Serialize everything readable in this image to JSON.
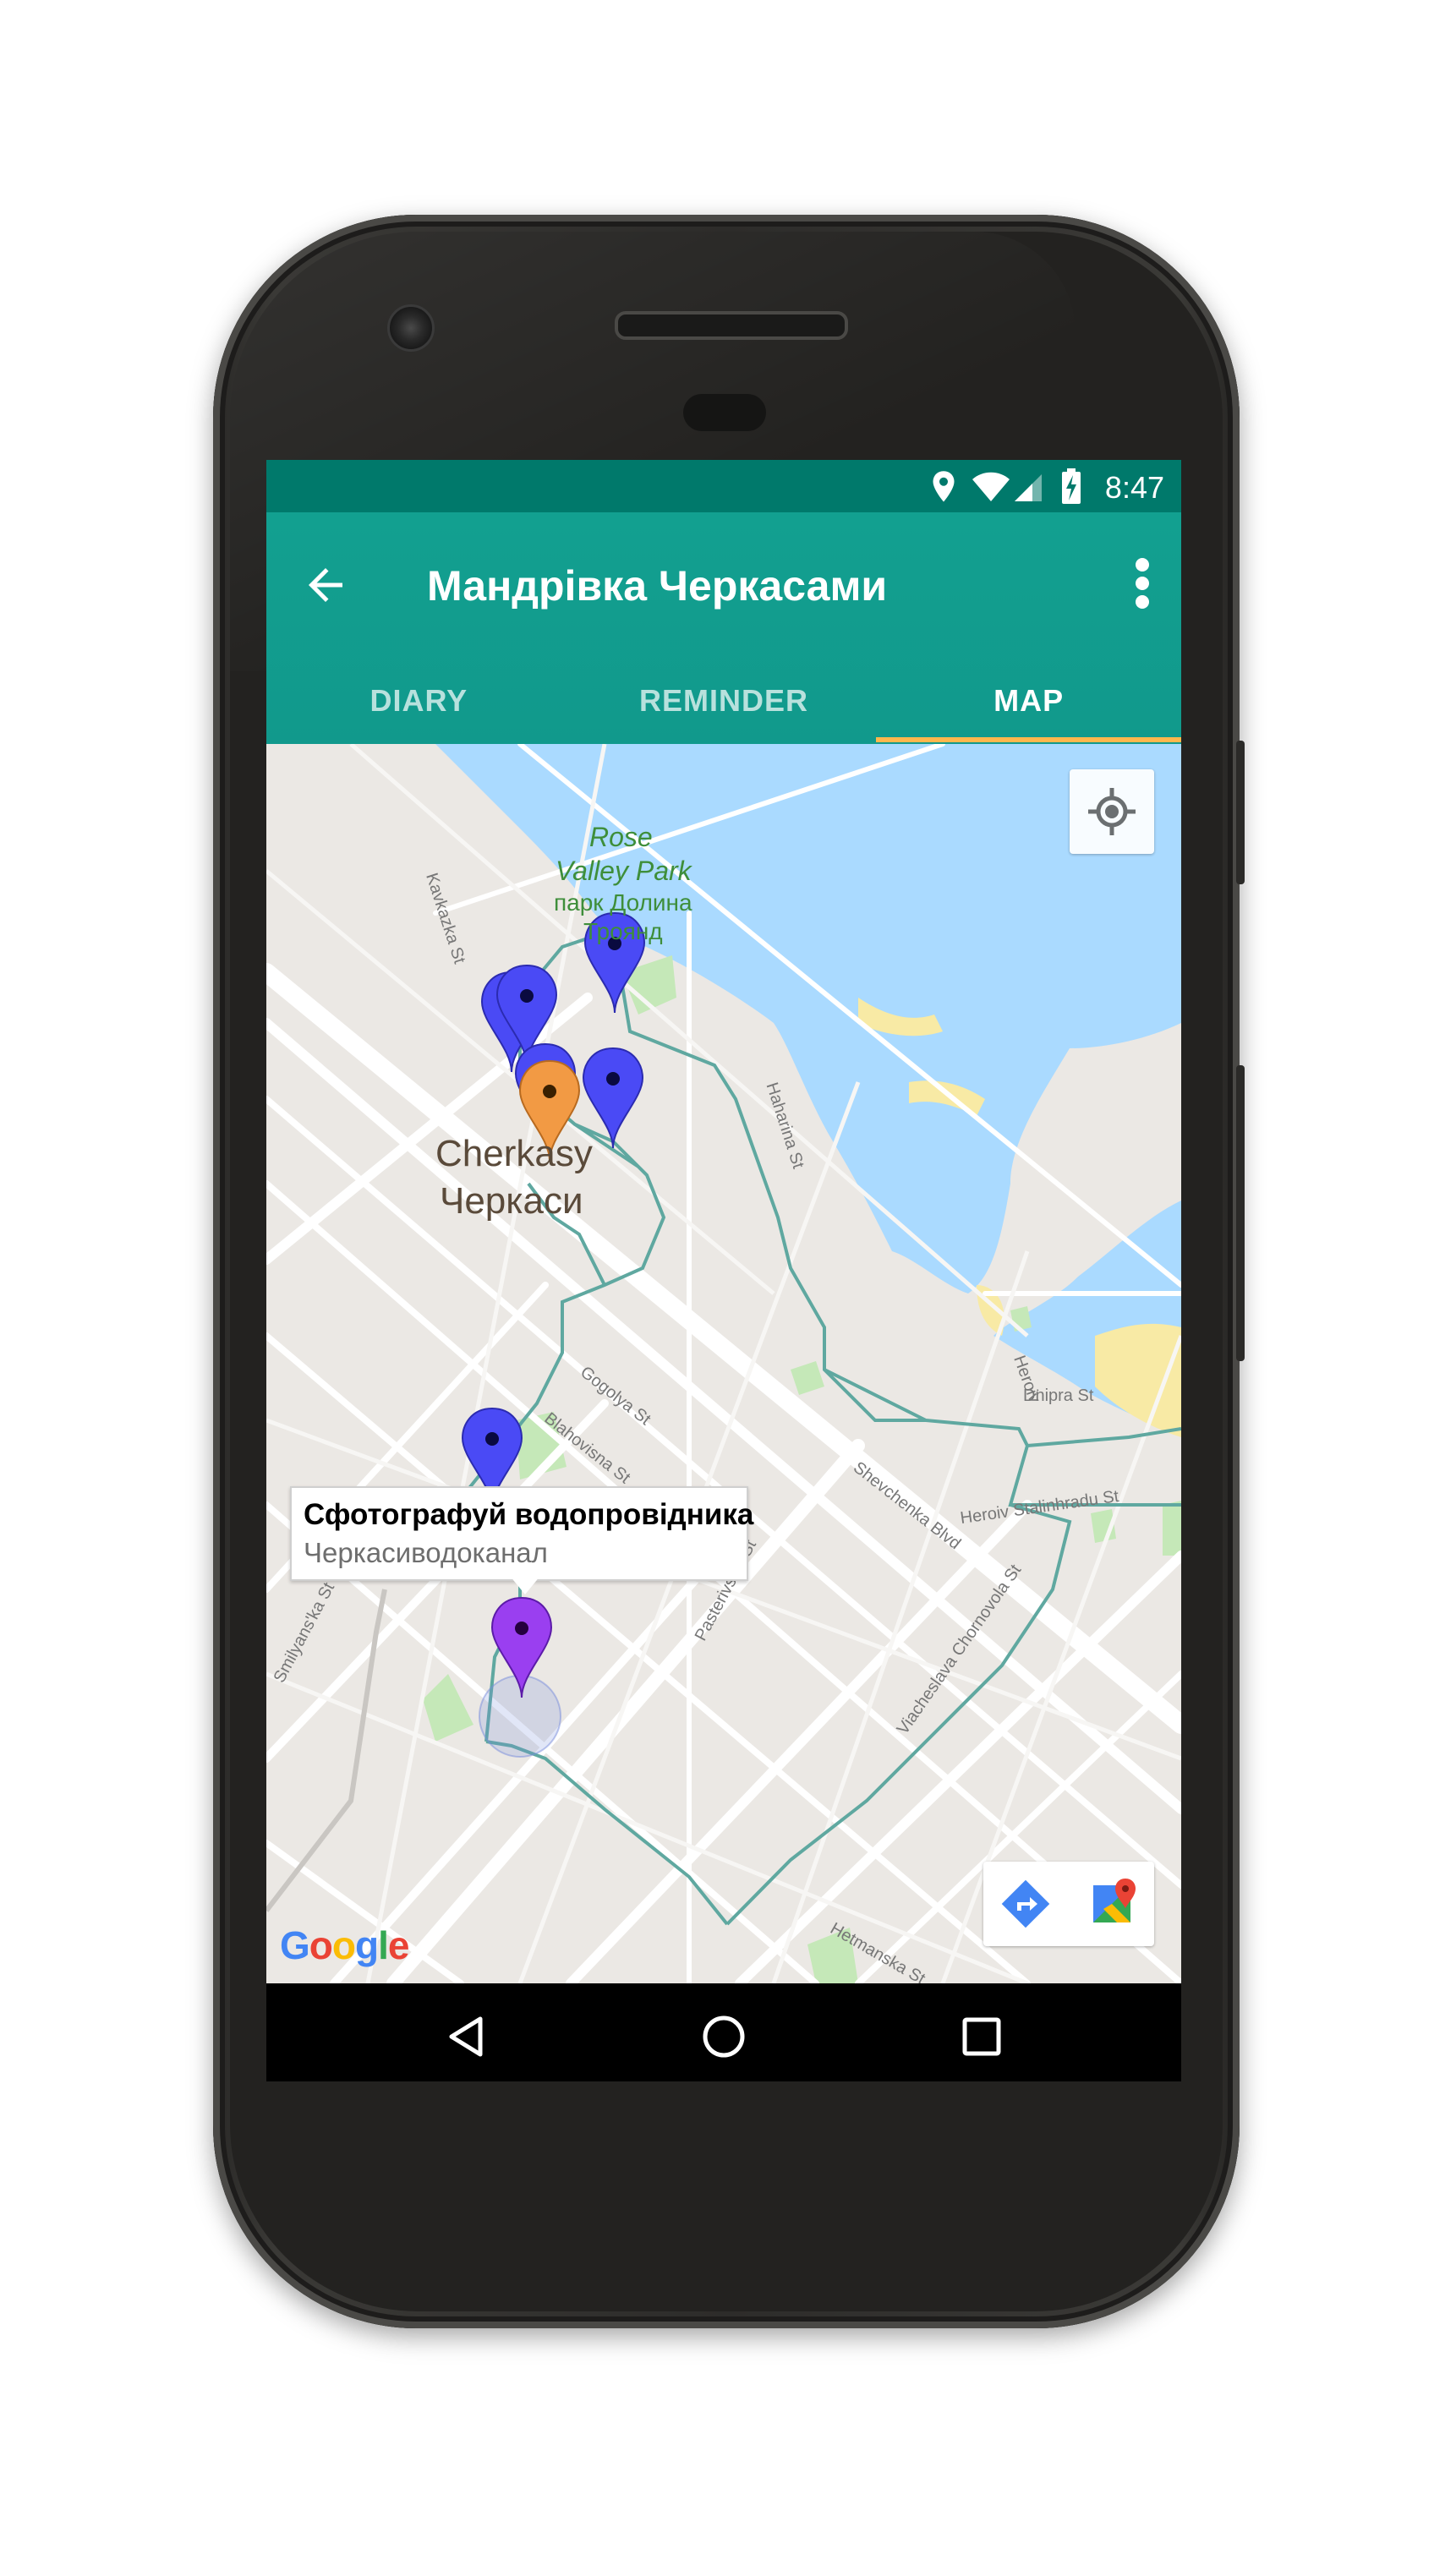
{
  "status_bar": {
    "time": "8:47",
    "icons": [
      "location-icon",
      "wifi-icon",
      "signal-icon",
      "battery-charging-icon"
    ]
  },
  "app_bar": {
    "title": "Мандрівка Черкасами",
    "back_icon": "arrow-back-icon",
    "menu_icon": "more-vert-icon"
  },
  "tabs": [
    {
      "label": "DIARY",
      "active": false
    },
    {
      "label": "REMINDER",
      "active": false
    },
    {
      "label": "MAP",
      "active": true
    }
  ],
  "map": {
    "park_label_en": [
      "Rose",
      "Valley Park"
    ],
    "park_label_uk": "парк Долина",
    "park_label_uk_2": "Троянд",
    "city_label_en": "Cherkasy",
    "city_label_uk": "Черкаси",
    "street_labels": [
      "Kavkazka St",
      "Haharina St",
      "Gogolya St",
      "Blahovisna St",
      "Shevchenka Blvd",
      "Heroiv Stalinhradu St",
      "Dnipra St",
      "Pasterivs'ka St",
      "Smilyans'ka St",
      "Viacheslava Chornovola St",
      "Hetmanska St",
      "Heroiv"
    ],
    "attribution": "Google",
    "info_window": {
      "title": "Сфотографуй водопровідника",
      "subtitle": "Черкасиводоканал"
    },
    "markers": {
      "blue": 6,
      "orange": 1,
      "purple": 1
    },
    "colors": {
      "water": "#aadaff",
      "land": "#ebe8e4",
      "park": "#c5e8b8",
      "route": "#5fa8a0",
      "sand": "#f8eaa5"
    }
  },
  "controls": {
    "locate": "my-location-icon",
    "directions": "directions-icon",
    "open_maps": "google-maps-icon"
  },
  "nav_bar": {
    "back": "nav-back-icon",
    "home": "nav-home-icon",
    "recents": "nav-recents-icon"
  },
  "theme": {
    "primary": "#009688",
    "primary_dark": "#00796b",
    "accent": "#ffb74d"
  }
}
